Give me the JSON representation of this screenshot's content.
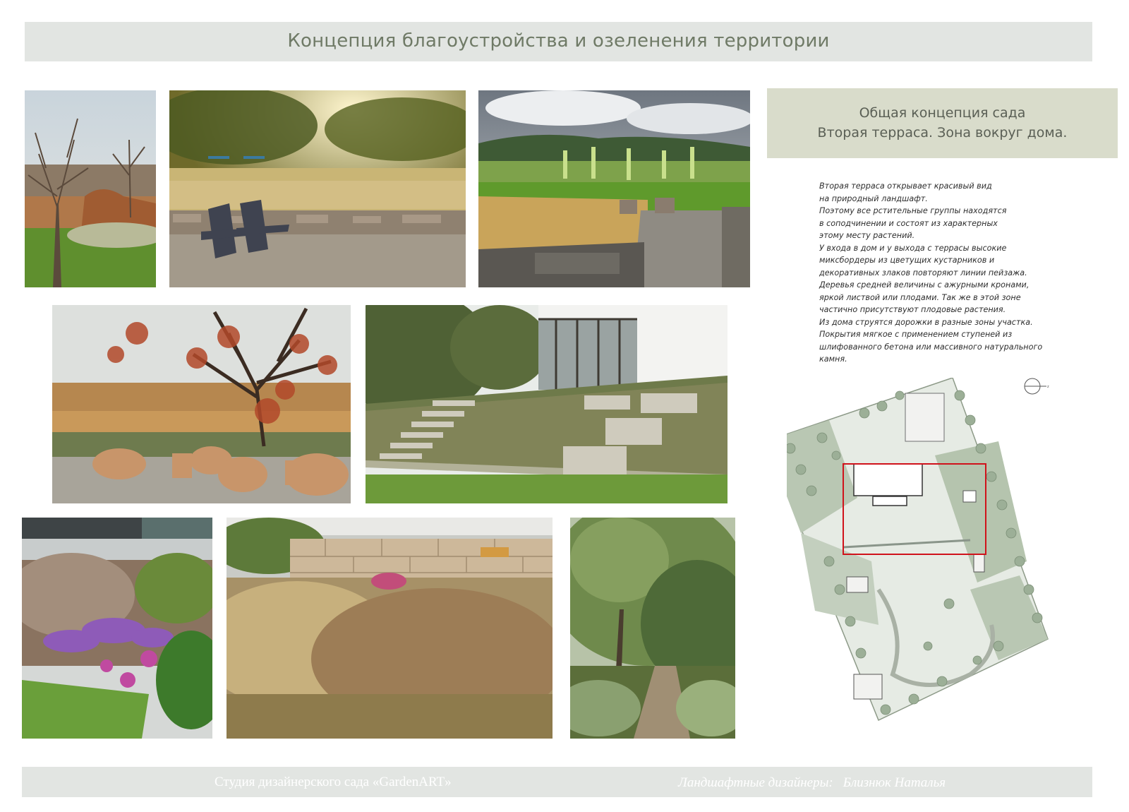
{
  "header": {
    "title": "Концепция благоустройства и озеленения территории"
  },
  "concept": {
    "line1": "Общая концепция сада",
    "line2": "Вторая терраса. Зона вокруг дома."
  },
  "description": {
    "lines": [
      "Вторая терраса открывает красивый вид",
      "на природный ландшафт.",
      "Поэтому все рстительные группы находятся",
      "в соподчинении и состоят из характерных",
      "этому месту растений.",
      "У входа в дом и у выхода с террасы высокие",
      "миксбордеры из цветущих кустарников и",
      "декоративных злаков повторяют линии пейзажа.",
      "Деревья средней величины с ажурными кронами,",
      "яркой листвой или плодами. Так же в этой зоне",
      "частично присутствуют плодовые растения.",
      "Из дома струятся дорожки в разные зоны участка.",
      "Покрытия мягкое с применением ступеней из",
      "шлифованного бетона или массивного натурального",
      "камня."
    ]
  },
  "photos": [
    {
      "id": "photo-bare-tree-grasses",
      "icon": "landscape-photo"
    },
    {
      "id": "photo-adirondack-chairs",
      "icon": "landscape-photo"
    },
    {
      "id": "photo-valley-terrace",
      "icon": "landscape-photo"
    },
    {
      "id": "photo-autumn-tree-seats",
      "icon": "landscape-photo"
    },
    {
      "id": "photo-house-steps-slope",
      "icon": "landscape-photo"
    },
    {
      "id": "photo-purple-flowers-border",
      "icon": "landscape-photo"
    },
    {
      "id": "photo-stone-wall-grasses",
      "icon": "landscape-photo"
    },
    {
      "id": "photo-willow-path",
      "icon": "landscape-photo"
    }
  ],
  "site_plan": {
    "icon": "site-plan-map",
    "compass_icon": "north-compass-icon",
    "compass_label": "z"
  },
  "footer": {
    "studio": "Студия дизайнерского сада «GardenART»",
    "designers_label": "Ландшафтные дизайнеры:",
    "designer_name": "Близнюк Наталья"
  },
  "colors": {
    "banner": "#e2e5e2",
    "concept_box": "#d9dccb",
    "title_text": "#6f7a66",
    "highlight_frame": "#d0121b"
  }
}
